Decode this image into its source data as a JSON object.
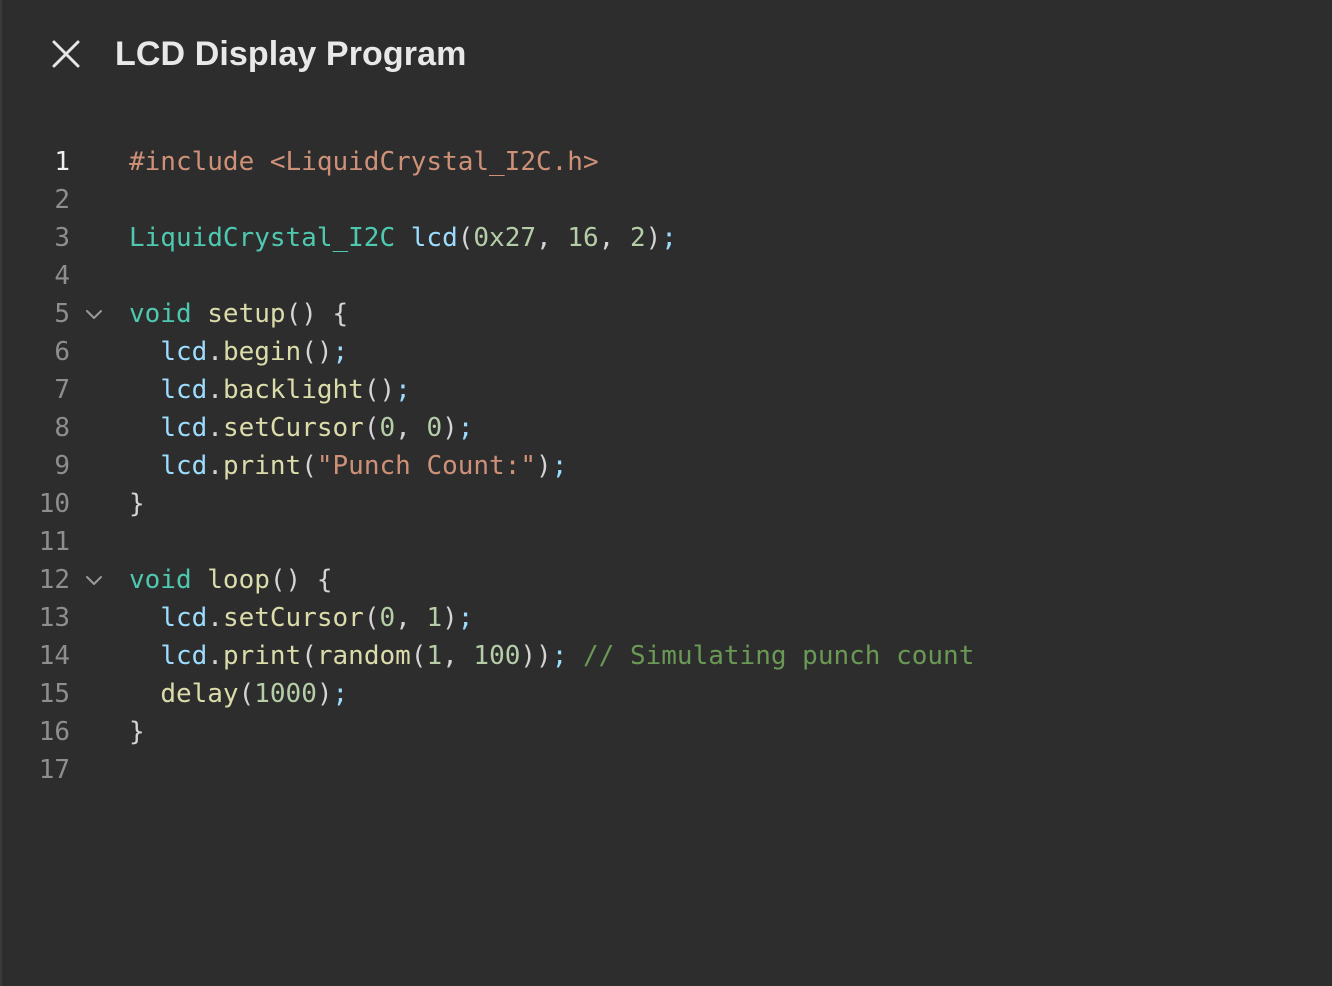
{
  "header": {
    "title": "LCD Display Program",
    "close_icon": "close-icon"
  },
  "editor": {
    "active_line": 1,
    "lines": [
      {
        "n": "1",
        "fold": false,
        "tokens": [
          {
            "t": "pre",
            "v": "#include <LiquidCrystal_I2C.h>"
          }
        ]
      },
      {
        "n": "2",
        "fold": false,
        "tokens": []
      },
      {
        "n": "3",
        "fold": false,
        "tokens": [
          {
            "t": "type",
            "v": "LiquidCrystal_I2C"
          },
          {
            "t": "punc",
            "v": " "
          },
          {
            "t": "var",
            "v": "lcd"
          },
          {
            "t": "punc",
            "v": "("
          },
          {
            "t": "num",
            "v": "0x27"
          },
          {
            "t": "punc",
            "v": ", "
          },
          {
            "t": "num",
            "v": "16"
          },
          {
            "t": "punc",
            "v": ", "
          },
          {
            "t": "num",
            "v": "2"
          },
          {
            "t": "punc",
            "v": ")"
          },
          {
            "t": "var",
            "v": ";"
          }
        ]
      },
      {
        "n": "4",
        "fold": false,
        "tokens": []
      },
      {
        "n": "5",
        "fold": true,
        "tokens": [
          {
            "t": "kw",
            "v": "void"
          },
          {
            "t": "punc",
            "v": " "
          },
          {
            "t": "fn",
            "v": "setup"
          },
          {
            "t": "punc",
            "v": "() {"
          }
        ]
      },
      {
        "n": "6",
        "fold": false,
        "tokens": [
          {
            "t": "punc",
            "v": "  "
          },
          {
            "t": "var",
            "v": "lcd"
          },
          {
            "t": "punc",
            "v": "."
          },
          {
            "t": "fn",
            "v": "begin"
          },
          {
            "t": "punc",
            "v": "()"
          },
          {
            "t": "var",
            "v": ";"
          }
        ]
      },
      {
        "n": "7",
        "fold": false,
        "tokens": [
          {
            "t": "punc",
            "v": "  "
          },
          {
            "t": "var",
            "v": "lcd"
          },
          {
            "t": "punc",
            "v": "."
          },
          {
            "t": "fn",
            "v": "backlight"
          },
          {
            "t": "punc",
            "v": "()"
          },
          {
            "t": "var",
            "v": ";"
          }
        ]
      },
      {
        "n": "8",
        "fold": false,
        "tokens": [
          {
            "t": "punc",
            "v": "  "
          },
          {
            "t": "var",
            "v": "lcd"
          },
          {
            "t": "punc",
            "v": "."
          },
          {
            "t": "fn",
            "v": "setCursor"
          },
          {
            "t": "punc",
            "v": "("
          },
          {
            "t": "num",
            "v": "0"
          },
          {
            "t": "punc",
            "v": ", "
          },
          {
            "t": "num",
            "v": "0"
          },
          {
            "t": "punc",
            "v": ")"
          },
          {
            "t": "var",
            "v": ";"
          }
        ]
      },
      {
        "n": "9",
        "fold": false,
        "tokens": [
          {
            "t": "punc",
            "v": "  "
          },
          {
            "t": "var",
            "v": "lcd"
          },
          {
            "t": "punc",
            "v": "."
          },
          {
            "t": "fn",
            "v": "print"
          },
          {
            "t": "punc",
            "v": "("
          },
          {
            "t": "str",
            "v": "\"Punch Count:\""
          },
          {
            "t": "punc",
            "v": ")"
          },
          {
            "t": "var",
            "v": ";"
          }
        ]
      },
      {
        "n": "10",
        "fold": false,
        "tokens": [
          {
            "t": "punc",
            "v": "}"
          }
        ]
      },
      {
        "n": "11",
        "fold": false,
        "tokens": []
      },
      {
        "n": "12",
        "fold": true,
        "tokens": [
          {
            "t": "kw",
            "v": "void"
          },
          {
            "t": "punc",
            "v": " "
          },
          {
            "t": "fn",
            "v": "loop"
          },
          {
            "t": "punc",
            "v": "() {"
          }
        ]
      },
      {
        "n": "13",
        "fold": false,
        "tokens": [
          {
            "t": "punc",
            "v": "  "
          },
          {
            "t": "var",
            "v": "lcd"
          },
          {
            "t": "punc",
            "v": "."
          },
          {
            "t": "fn",
            "v": "setCursor"
          },
          {
            "t": "punc",
            "v": "("
          },
          {
            "t": "num",
            "v": "0"
          },
          {
            "t": "punc",
            "v": ", "
          },
          {
            "t": "num",
            "v": "1"
          },
          {
            "t": "punc",
            "v": ")"
          },
          {
            "t": "var",
            "v": ";"
          }
        ]
      },
      {
        "n": "14",
        "fold": false,
        "tokens": [
          {
            "t": "punc",
            "v": "  "
          },
          {
            "t": "var",
            "v": "lcd"
          },
          {
            "t": "punc",
            "v": "."
          },
          {
            "t": "fn",
            "v": "print"
          },
          {
            "t": "punc",
            "v": "("
          },
          {
            "t": "fn",
            "v": "random"
          },
          {
            "t": "punc",
            "v": "("
          },
          {
            "t": "num",
            "v": "1"
          },
          {
            "t": "punc",
            "v": ", "
          },
          {
            "t": "num",
            "v": "100"
          },
          {
            "t": "punc",
            "v": "))"
          },
          {
            "t": "var",
            "v": ";"
          },
          {
            "t": "punc",
            "v": " "
          },
          {
            "t": "cmt",
            "v": "// Simulating punch count"
          }
        ]
      },
      {
        "n": "15",
        "fold": false,
        "tokens": [
          {
            "t": "punc",
            "v": "  "
          },
          {
            "t": "fn",
            "v": "delay"
          },
          {
            "t": "punc",
            "v": "("
          },
          {
            "t": "num",
            "v": "1000"
          },
          {
            "t": "punc",
            "v": ")"
          },
          {
            "t": "var",
            "v": ";"
          }
        ]
      },
      {
        "n": "16",
        "fold": false,
        "tokens": [
          {
            "t": "punc",
            "v": "}"
          }
        ]
      },
      {
        "n": "17",
        "fold": false,
        "tokens": []
      }
    ]
  },
  "colors": {
    "background": "#2d2d2d",
    "title": "#e8e8e8",
    "line_number": "#8e8e8e",
    "line_number_active": "#f0f0f0",
    "preprocessor": "#ce9178",
    "type": "#4ec9b0",
    "variable": "#9cdcfe",
    "number": "#b5cea8",
    "function": "#dcdcaa",
    "string": "#ce9178",
    "comment": "#6a9955"
  }
}
